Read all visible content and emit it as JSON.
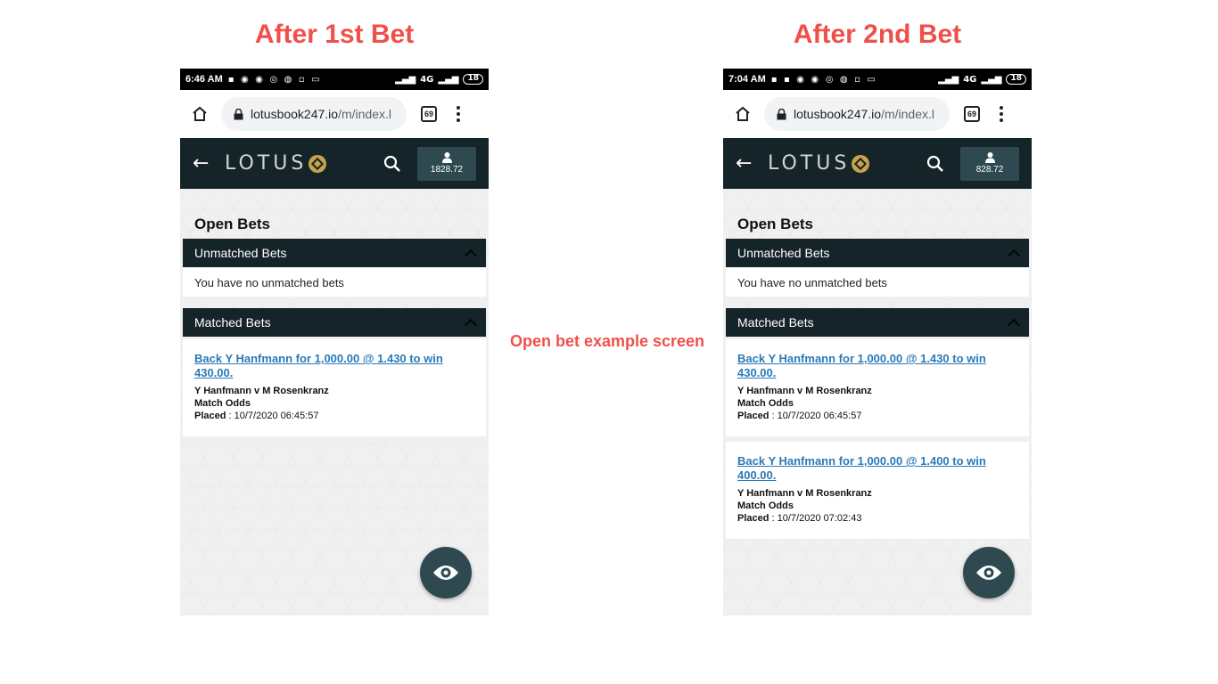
{
  "headings": {
    "left": "After 1st Bet",
    "right": "After 2nd Bet"
  },
  "caption": "Open bet example screen",
  "phones": [
    {
      "status": {
        "time": "6:46 AM",
        "signal": "4G",
        "battery": "18"
      },
      "browser": {
        "url_host": "lotusbook247.io",
        "url_path": "/m/index.l",
        "tab_count": "69"
      },
      "app": {
        "logo": "LOTUS",
        "balance": "1828.72"
      },
      "page_title": "Open Bets",
      "unmatched": {
        "header": "Unmatched Bets",
        "empty_text": "You have no unmatched bets"
      },
      "matched": {
        "header": "Matched Bets",
        "bets": [
          {
            "link": "Back Y Hanfmann for 1,000.00 @ 1.430 to win 430.00.",
            "teams": "Y Hanfmann v M Rosenkranz",
            "market": "Match Odds",
            "placed_label": "Placed",
            "placed_value": " : 10/7/2020 06:45:57"
          }
        ]
      }
    },
    {
      "status": {
        "time": "7:04 AM",
        "signal": "4G",
        "battery": "18"
      },
      "browser": {
        "url_host": "lotusbook247.io",
        "url_path": "/m/index.l",
        "tab_count": "69"
      },
      "app": {
        "logo": "LOTUS",
        "balance": "828.72"
      },
      "page_title": "Open Bets",
      "unmatched": {
        "header": "Unmatched Bets",
        "empty_text": "You have no unmatched bets"
      },
      "matched": {
        "header": "Matched Bets",
        "bets": [
          {
            "link": "Back Y Hanfmann for 1,000.00 @ 1.430 to win 430.00.",
            "teams": "Y Hanfmann v M Rosenkranz",
            "market": "Match Odds",
            "placed_label": "Placed",
            "placed_value": " : 10/7/2020 06:45:57"
          },
          {
            "link": "Back Y Hanfmann for 1,000.00 @ 1.400 to win 400.00.",
            "teams": "Y Hanfmann v M Rosenkranz",
            "market": "Match Odds",
            "placed_label": "Placed",
            "placed_value": " : 10/7/2020 07:02:43"
          }
        ]
      }
    }
  ],
  "colors": {
    "accent": "#f0504a",
    "appbar": "#142428",
    "account_btn": "#2e4a50",
    "link": "#2a7ab8",
    "logo_gold": "#c9a24a"
  },
  "icons": [
    "home-icon",
    "lock-icon",
    "menu-icon",
    "back-arrow-icon",
    "search-icon",
    "user-icon",
    "eye-icon",
    "chevron-up-icon"
  ]
}
